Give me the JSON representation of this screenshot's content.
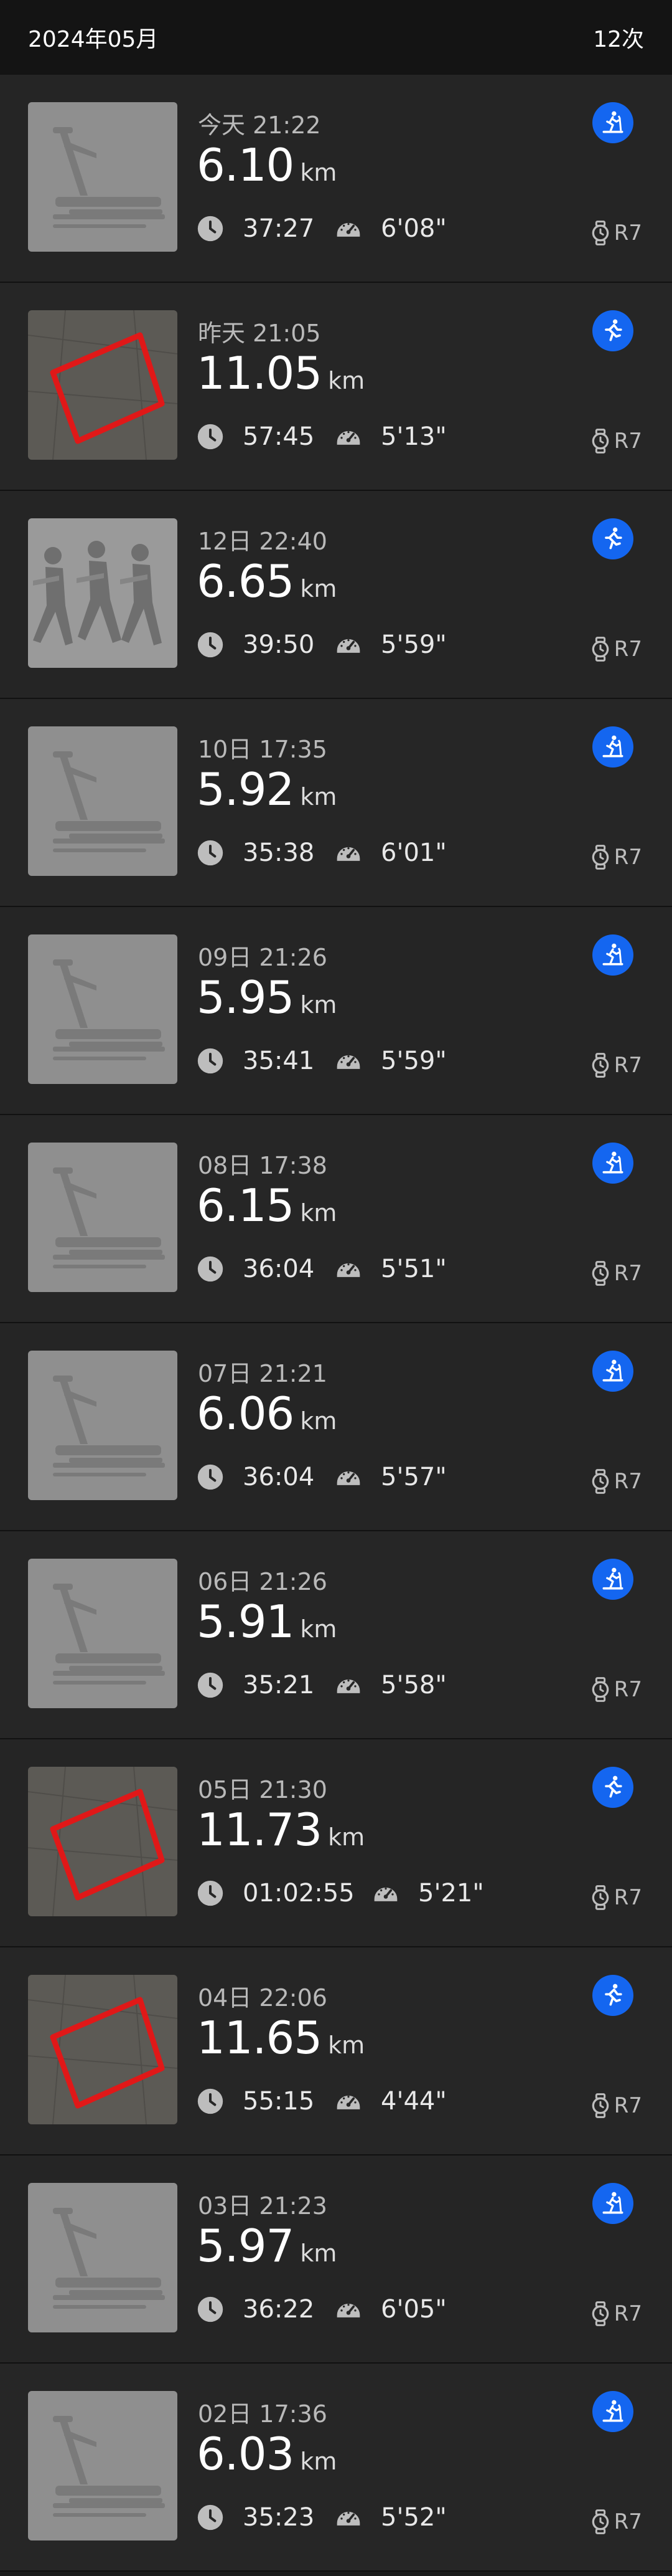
{
  "header": {
    "month": "2024年05月",
    "count": "12次"
  },
  "icons": {
    "time": "clock-icon",
    "pace": "speedometer-icon",
    "device": "watch-icon",
    "treadmill": "treadmill-icon",
    "outdoor": "running-icon"
  },
  "colors": {
    "accent": "#1466f0",
    "route": "#e01818"
  },
  "activities": [
    {
      "date": "今天 21:22",
      "distance": "6.10",
      "unit": "km",
      "duration": "37:27",
      "pace": "6'08\"",
      "device": "R7",
      "type": "treadmill"
    },
    {
      "date": "昨天 21:05",
      "distance": "11.05",
      "unit": "km",
      "duration": "57:45",
      "pace": "5'13\"",
      "device": "R7",
      "type": "outdoor",
      "thumb": "route"
    },
    {
      "date": "12日 22:40",
      "distance": "6.65",
      "unit": "km",
      "duration": "39:50",
      "pace": "5'59\"",
      "device": "R7",
      "type": "outdoor",
      "thumb": "runners"
    },
    {
      "date": "10日 17:35",
      "distance": "5.92",
      "unit": "km",
      "duration": "35:38",
      "pace": "6'01\"",
      "device": "R7",
      "type": "treadmill"
    },
    {
      "date": "09日 21:26",
      "distance": "5.95",
      "unit": "km",
      "duration": "35:41",
      "pace": "5'59\"",
      "device": "R7",
      "type": "treadmill"
    },
    {
      "date": "08日 17:38",
      "distance": "6.15",
      "unit": "km",
      "duration": "36:04",
      "pace": "5'51\"",
      "device": "R7",
      "type": "treadmill"
    },
    {
      "date": "07日 21:21",
      "distance": "6.06",
      "unit": "km",
      "duration": "36:04",
      "pace": "5'57\"",
      "device": "R7",
      "type": "treadmill"
    },
    {
      "date": "06日 21:26",
      "distance": "5.91",
      "unit": "km",
      "duration": "35:21",
      "pace": "5'58\"",
      "device": "R7",
      "type": "treadmill"
    },
    {
      "date": "05日 21:30",
      "distance": "11.73",
      "unit": "km",
      "duration": "01:02:55",
      "pace": "5'21\"",
      "device": "R7",
      "type": "outdoor",
      "thumb": "route"
    },
    {
      "date": "04日 22:06",
      "distance": "11.65",
      "unit": "km",
      "duration": "55:15",
      "pace": "4'44\"",
      "device": "R7",
      "type": "outdoor",
      "thumb": "route"
    },
    {
      "date": "03日 21:23",
      "distance": "5.97",
      "unit": "km",
      "duration": "36:22",
      "pace": "6'05\"",
      "device": "R7",
      "type": "treadmill"
    },
    {
      "date": "02日 17:36",
      "distance": "6.03",
      "unit": "km",
      "duration": "35:23",
      "pace": "5'52\"",
      "device": "R7",
      "type": "treadmill"
    }
  ]
}
